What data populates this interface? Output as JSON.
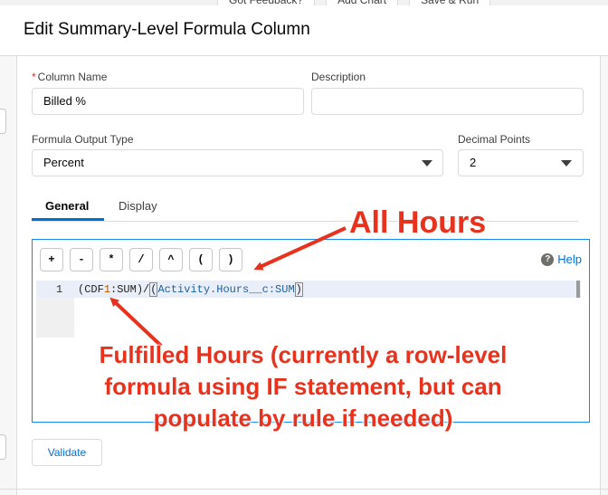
{
  "background": {
    "tabs": [
      "Got Feedback?",
      "Add Chart",
      "Save & Run"
    ]
  },
  "modal": {
    "title": "Edit Summary-Level Formula Column"
  },
  "form": {
    "column_name": {
      "required_mark": "*",
      "label": "Column Name",
      "value": "Billed %"
    },
    "description": {
      "label": "Description",
      "value": ""
    },
    "output_type": {
      "label": "Formula Output Type",
      "value": "Percent"
    },
    "decimal_points": {
      "label": "Decimal Points",
      "value": "2"
    }
  },
  "tabs": [
    {
      "label": "General",
      "active": true
    },
    {
      "label": "Display",
      "active": false
    }
  ],
  "editor": {
    "operators": [
      "+",
      "-",
      "*",
      "/",
      "^",
      "(",
      ")"
    ],
    "help_label": "Help",
    "help_icon": "?",
    "line_number": "1",
    "formula": {
      "p1": "(CDF",
      "n1": "1",
      "p2": ":SUM)/",
      "p3": "(",
      "ref": "Activity.Hours__c:SUM",
      "p4": ")"
    }
  },
  "validate_label": "Validate",
  "annotations": {
    "all_hours": "All Hours",
    "fulfilled_hours": "Fulfilled Hours (currently a row-level formula using IF statement, but can populate by rule if needed)",
    "color": "#e8321e"
  },
  "colors": {
    "accent": "#0070d2",
    "required": "#c23934",
    "border": "#dddbda",
    "focus": "#1589ee"
  }
}
